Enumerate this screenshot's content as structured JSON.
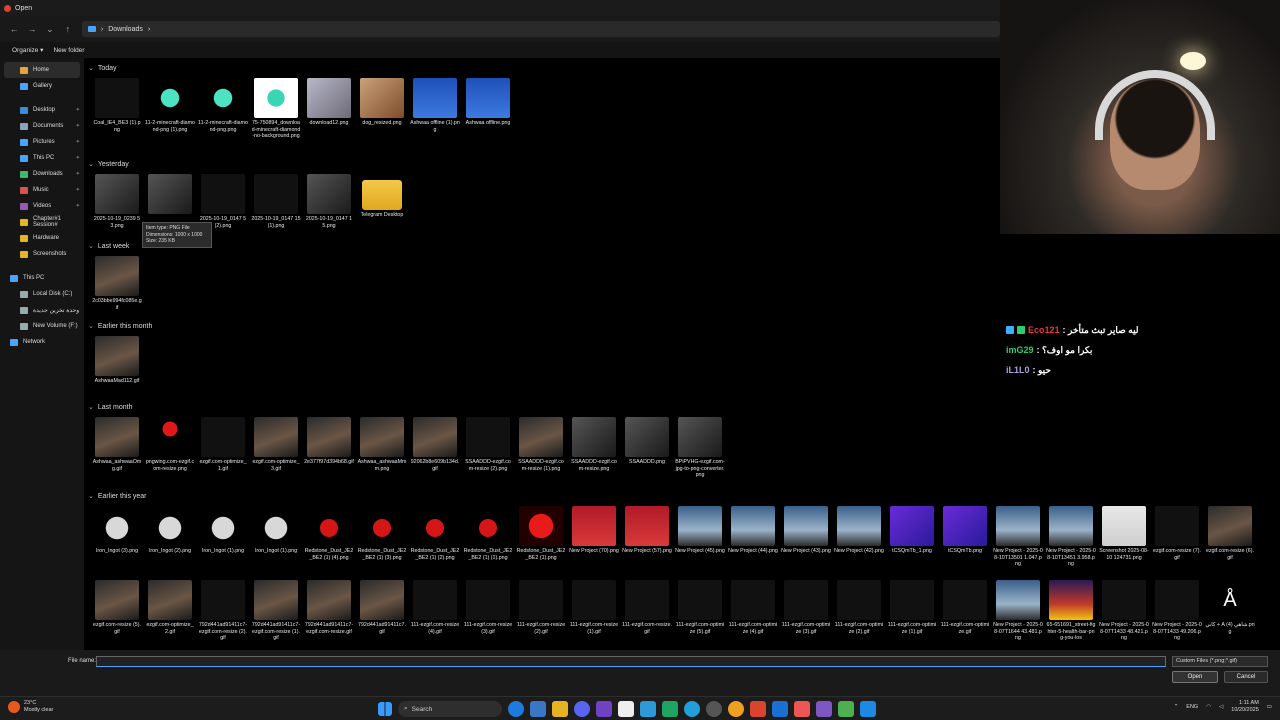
{
  "window": {
    "title": "Open"
  },
  "address": {
    "path": "Downloads"
  },
  "commands": {
    "organize": "Organize ▾",
    "new_folder": "New folder"
  },
  "sidebar": {
    "items": [
      {
        "label": "Home",
        "icon": "home-icon",
        "color": "#e6a23c",
        "selected": true
      },
      {
        "label": "Gallery",
        "icon": "gallery-icon",
        "color": "#4aa3ff"
      },
      {
        "label": "Desktop",
        "icon": "desktop-icon",
        "color": "#3d8bd9",
        "pinned": true
      },
      {
        "label": "Documents",
        "icon": "documents-icon",
        "color": "#8aa5c0",
        "pinned": true
      },
      {
        "label": "Pictures",
        "icon": "pictures-icon",
        "color": "#4aa3ff",
        "pinned": true
      },
      {
        "label": "This PC",
        "icon": "pc-icon",
        "color": "#4aa3ff",
        "pinned": true
      },
      {
        "label": "Downloads",
        "icon": "downloads-icon",
        "color": "#3dbb6a",
        "pinned": true
      },
      {
        "label": "Music",
        "icon": "music-icon",
        "color": "#d9534f",
        "pinned": true
      },
      {
        "label": "Videos",
        "icon": "videos-icon",
        "color": "#9b59b6",
        "pinned": true
      },
      {
        "label": "Chapter#1 Session#",
        "icon": "folder-icon",
        "color": "#e6b422"
      },
      {
        "label": "Hardware",
        "icon": "folder-icon",
        "color": "#e6b422"
      },
      {
        "label": "Screenshots",
        "icon": "folder-icon",
        "color": "#e6b422"
      }
    ],
    "tree": [
      {
        "label": "This PC",
        "icon": "pc-icon",
        "color": "#4aa3ff",
        "level": 0
      },
      {
        "label": "Local Disk (C:)",
        "icon": "drive-icon",
        "color": "#9aa",
        "level": 1
      },
      {
        "label": "وحدة تخزين جديدة",
        "icon": "drive-icon",
        "color": "#9aa",
        "level": 1
      },
      {
        "label": "New Volume (F:)",
        "icon": "drive-icon",
        "color": "#9aa",
        "level": 1
      },
      {
        "label": "Network",
        "icon": "network-icon",
        "color": "#4aa3ff",
        "level": 0
      }
    ]
  },
  "groups": [
    {
      "label": "Today",
      "files": [
        {
          "name": "Coal_IE4_BE3 (1).png",
          "thumb": "t-dark"
        },
        {
          "name": "11-2-minecraft-diamond-png (1).png",
          "thumb": "t-gem"
        },
        {
          "name": "11-2-minecraft-diamond-png.png",
          "thumb": "t-gem"
        },
        {
          "name": "75-750894_download-minecraft-diamond-no-background.png",
          "thumb": "t-gemw"
        },
        {
          "name": "download12.png",
          "thumb": "t-cat"
        },
        {
          "name": "dog_resized.png",
          "thumb": "t-dog"
        },
        {
          "name": "Ashwaa offline (1).png",
          "thumb": "t-blue"
        },
        {
          "name": "Ashwaa offline.png",
          "thumb": "t-blue"
        }
      ]
    },
    {
      "label": "Yesterday",
      "files": [
        {
          "name": "2025-10-19_0239 53.png",
          "thumb": "t-bw"
        },
        {
          "name": "",
          "thumb": "t-bw"
        },
        {
          "name": "2025-10-19_0147 5 (2).png",
          "thumb": "t-dark"
        },
        {
          "name": "2025-10-19_0147 15 (1).png",
          "thumb": "t-dark"
        },
        {
          "name": "2025-10-19_0147 15.png",
          "thumb": "t-bw"
        },
        {
          "name": "Telegram Desktop",
          "thumb": "t-folder"
        }
      ]
    },
    {
      "label": "Last week",
      "files": [
        {
          "name": "2c03bbe994fc085e.gif",
          "thumb": "t-face"
        }
      ]
    },
    {
      "label": "Earlier this month",
      "files": [
        {
          "name": "AshwaaMad112.gif",
          "thumb": "t-face"
        }
      ]
    },
    {
      "label": "Last month",
      "files": [
        {
          "name": "Ashwaa_ashwaaOmg.gif",
          "thumb": "t-face"
        },
        {
          "name": "pngwing.com-ezgif.com-resize.png",
          "thumb": "t-rose"
        },
        {
          "name": "ezgif.com-optimize_1.gif",
          "thumb": "t-dark"
        },
        {
          "name": "ezgif.com-optimize_3.gif",
          "thumb": "t-face"
        },
        {
          "name": "2e377f97d394b68.gif",
          "thumb": "t-face"
        },
        {
          "name": "Ashwaa_ashwaaMmm.png",
          "thumb": "t-face"
        },
        {
          "name": "92062b8e609b134d.gif",
          "thumb": "t-face"
        },
        {
          "name": "SSAADDD-ezgif.com-resize (2).png",
          "thumb": "t-dark"
        },
        {
          "name": "SSAADDD-ezgif.com-resize (1).png",
          "thumb": "t-face"
        },
        {
          "name": "SSAADDD-ezgif.com-resize.png",
          "thumb": "t-bw"
        },
        {
          "name": "SSAADDD.png",
          "thumb": "t-bw"
        },
        {
          "name": "BPiPVHG-ezgif.com-jpg-to-png-converter.png",
          "thumb": "t-bw"
        }
      ]
    },
    {
      "label": "Earlier this year",
      "files": [
        {
          "name": "Iron_Ingot (3).png",
          "thumb": "t-ingot"
        },
        {
          "name": "Iron_Ingot (2).png",
          "thumb": "t-ingot"
        },
        {
          "name": "Iron_Ingot (1).png",
          "thumb": "t-ingot"
        },
        {
          "name": "Iron_Ingot (1).png",
          "thumb": "t-ingot"
        },
        {
          "name": "Redstone_Dust_JE2_BE2 (1) (4).png",
          "thumb": "t-red"
        },
        {
          "name": "Redstone_Dust_JE2_BE2 (1) (3).png",
          "thumb": "t-red"
        },
        {
          "name": "Redstone_Dust_JE2_BE2 (1) (2).png",
          "thumb": "t-red"
        },
        {
          "name": "Redstone_Dust_JE2_BE2 (1) (1).png",
          "thumb": "t-red"
        },
        {
          "name": "Redstone_Dust_JE2_BE2 (1).png",
          "thumb": "t-redbig"
        },
        {
          "name": "New Project (70).png",
          "thumb": "t-proj"
        },
        {
          "name": "New Project (57).png",
          "thumb": "t-proj"
        },
        {
          "name": "New Project (45).png",
          "thumb": "t-stadium"
        },
        {
          "name": "New Project (44).png",
          "thumb": "t-stadium"
        },
        {
          "name": "New Project (43).png",
          "thumb": "t-stadium"
        },
        {
          "name": "New Project (42).png",
          "thumb": "t-stadium"
        },
        {
          "name": "tCSQmTb_1.png",
          "thumb": "t-purple"
        },
        {
          "name": "tCSQmTb.png",
          "thumb": "t-purple"
        },
        {
          "name": "New Project - 2025-08-10T13501 1.047.png",
          "thumb": "t-stadium"
        },
        {
          "name": "New Project - 2025-08-10T13451 3.958.png",
          "thumb": "t-stadium"
        },
        {
          "name": "Screenshot 2025-08-10 124731.png",
          "thumb": "t-shot"
        },
        {
          "name": "ezgif.com-resize (7).gif",
          "thumb": "t-dark"
        },
        {
          "name": "ezgif.com-resize (6).gif",
          "thumb": "t-face"
        },
        {
          "name": "ezgif.com-resize (5).gif",
          "thumb": "t-face"
        },
        {
          "name": "ezgif.com-optimize_2.gif",
          "thumb": "t-face"
        },
        {
          "name": "792d441ad91411c7-ezgif.com-resize (2).gif",
          "thumb": "t-dark"
        },
        {
          "name": "792d441ad91411c7-ezgif.com-resize (1).gif",
          "thumb": "t-face"
        },
        {
          "name": "792d441ad91411c7-ezgif.com-resize.gif",
          "thumb": "t-face"
        },
        {
          "name": "792d441ad91411c7.gif",
          "thumb": "t-face"
        },
        {
          "name": "111-ezgif.com-resize (4).gif",
          "thumb": "t-dark"
        },
        {
          "name": "111-ezgif.com-resize (3).gif",
          "thumb": "t-dark"
        },
        {
          "name": "111-ezgif.com-resize (2).gif",
          "thumb": "t-dark"
        },
        {
          "name": "111-ezgif.com-resize (1).gif",
          "thumb": "t-dark"
        },
        {
          "name": "111-ezgif.com-resize.gif",
          "thumb": "t-dark"
        },
        {
          "name": "111-ezgif.com-optimize (5).gif",
          "thumb": "t-dark"
        },
        {
          "name": "111-ezgif.com-optimize (4).gif",
          "thumb": "t-dark"
        },
        {
          "name": "111-ezgif.com-optimize (3).gif",
          "thumb": "t-dark"
        },
        {
          "name": "111-ezgif.com-optimize (2).gif",
          "thumb": "t-dark"
        },
        {
          "name": "111-ezgif.com-optimize (1).gif",
          "thumb": "t-dark"
        },
        {
          "name": "111-ezgif.com-optimize.gif",
          "thumb": "t-dark"
        },
        {
          "name": "New Project - 2025-08-07T1644 43.481.png",
          "thumb": "t-stadium"
        },
        {
          "name": "65-651691_street-fighter-5-health-bar-png-you-los",
          "thumb": "t-poster"
        },
        {
          "name": "New Project - 2025-08-07T1433 48.421.png",
          "thumb": "t-dark"
        },
        {
          "name": "New Project - 2025-08-07T1433 49.206.png",
          "thumb": "t-dark"
        },
        {
          "name": "كابي + A شاهي (4).png",
          "thumb": "t-white-a",
          "glyph": "Å"
        }
      ]
    }
  ],
  "tooltip": {
    "line1": "Item type: PNG File",
    "line2": "Dimensions: 1000 x 1000",
    "line3": "Size: 235 KB"
  },
  "filename": {
    "label": "File name:",
    "value": ""
  },
  "filter": {
    "value": "Custom Files (*.png;*.gif)"
  },
  "buttons": {
    "open": "Open",
    "cancel": "Cancel"
  },
  "chat": [
    {
      "user": "Eco121",
      "user_color": "#e53935",
      "text": ": ليه صاير تبث متأخر",
      "badges": [
        "b",
        "g"
      ]
    },
    {
      "user": "imG29",
      "user_color": "#2ecc71",
      "text": ": بكرا مو اوف؟"
    },
    {
      "user": "iL1L0",
      "user_color": "#b39ddb",
      "text": ": حيو"
    }
  ],
  "taskbar": {
    "weather_temp": "23°C",
    "weather_desc": "Mostly clear",
    "search": "Search",
    "lang": "ENG",
    "time": "1:11 AM",
    "date": "10/20/2025"
  }
}
